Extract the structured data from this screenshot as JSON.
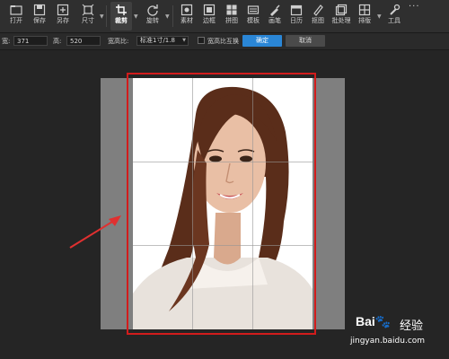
{
  "toolbar": {
    "tools": [
      {
        "name": "open",
        "label": "打开",
        "icon": "folder-icon"
      },
      {
        "name": "save",
        "label": "保存",
        "icon": "save-icon"
      },
      {
        "name": "save-as",
        "label": "另存",
        "icon": "save-as-icon"
      },
      {
        "name": "size",
        "label": "尺寸",
        "icon": "resize-icon"
      },
      {
        "name": "crop",
        "label": "裁剪",
        "icon": "crop-icon",
        "active": true
      },
      {
        "name": "rotate",
        "label": "旋转",
        "icon": "rotate-icon"
      },
      {
        "name": "material",
        "label": "素材",
        "icon": "material-icon"
      },
      {
        "name": "border",
        "label": "边框",
        "icon": "border-icon"
      },
      {
        "name": "collage",
        "label": "拼图",
        "icon": "collage-icon"
      },
      {
        "name": "template",
        "label": "模板",
        "icon": "template-icon"
      },
      {
        "name": "brush",
        "label": "画笔",
        "icon": "brush-icon"
      },
      {
        "name": "calendar",
        "label": "日历",
        "icon": "calendar-icon"
      },
      {
        "name": "cutout",
        "label": "抠图",
        "icon": "pen-icon"
      },
      {
        "name": "batch",
        "label": "批处理",
        "icon": "batch-icon"
      },
      {
        "name": "layout",
        "label": "排版",
        "icon": "layout-icon"
      },
      {
        "name": "tools",
        "label": "工具",
        "icon": "wrench-icon"
      }
    ],
    "more_label": "···"
  },
  "options": {
    "width_label": "宽:",
    "width_value": "371",
    "height_label": "高:",
    "height_value": "520",
    "ratio_label": "宽高比:",
    "ratio_value": "标准1寸/1.8",
    "swap_label": "宽高比互换",
    "ok_label": "确定",
    "cancel_label": "取消"
  },
  "watermark": {
    "logo": "Bai",
    "paw": "🐾",
    "text": "经验",
    "url": "jingyan.baidu.com"
  },
  "colors": {
    "accent": "#2a86d6",
    "crop_frame": "#d21c1c",
    "arrow": "#e03030"
  }
}
